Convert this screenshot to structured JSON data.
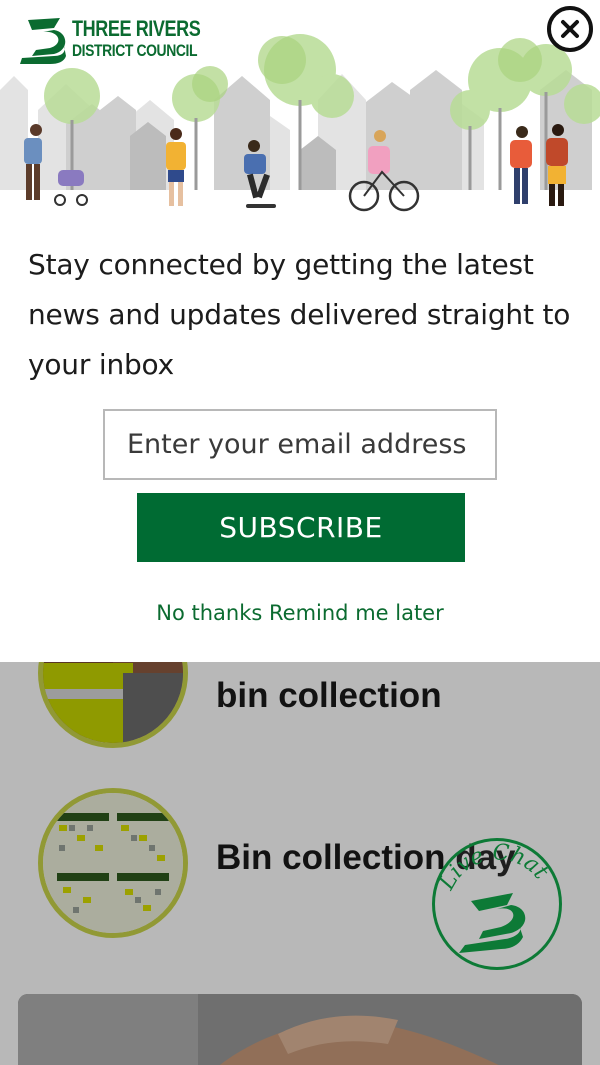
{
  "colors": {
    "brand_green": "#006b33",
    "link_green": "#0b6b30",
    "accent_lime": "#c9d44a",
    "overlay": "rgba(0,0,0,0.28)"
  },
  "modal": {
    "logo": {
      "line1": "THREE RIVERS",
      "line2": "DISTRICT COUNCIL",
      "icon": "three-rivers-logo-icon"
    },
    "close_icon": "close-icon",
    "message": "Stay connected by getting the latest news and updates delivered straight to your inbox",
    "email": {
      "placeholder": "Enter your email address",
      "value": ""
    },
    "subscribe_label": "SUBSCRIBE",
    "no_thanks_label": "No thanks",
    "remind_label": "Remind me later"
  },
  "background": {
    "services": [
      {
        "title": "bin collection",
        "icon": "bin-worker-photo"
      },
      {
        "title": "Bin collection day",
        "icon": "calendar-photo"
      }
    ],
    "hero_image": "handshake-photo"
  },
  "live_chat": {
    "label": "Live Chat",
    "icon": "three-rivers-logo-icon"
  }
}
